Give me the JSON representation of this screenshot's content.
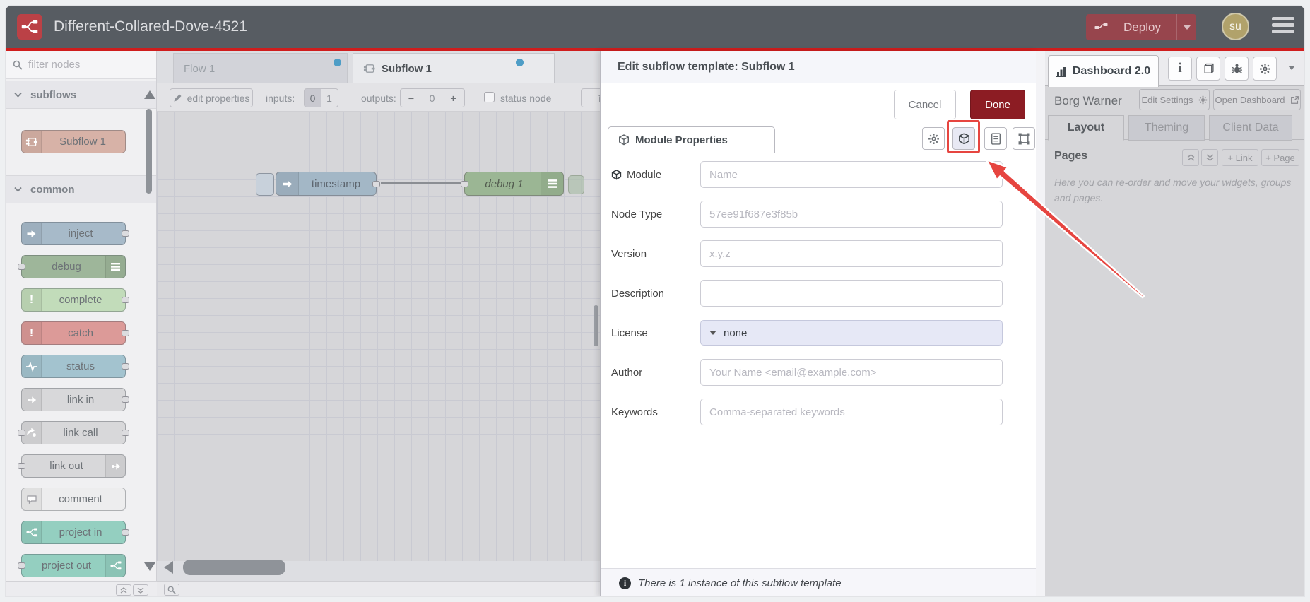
{
  "header": {
    "title": "Different-Collared-Dove-4521",
    "deploy_label": "Deploy",
    "avatar_initials": "su"
  },
  "palette": {
    "filter_placeholder": "filter nodes",
    "sections": [
      {
        "label": "subflows",
        "nodes": [
          {
            "label": "Subflow 1",
            "color": "#d7b2a7"
          }
        ]
      },
      {
        "label": "common",
        "nodes": [
          {
            "label": "inject",
            "color": "#a7bac9"
          },
          {
            "label": "debug",
            "color": "#9eb69a"
          },
          {
            "label": "complete",
            "color": "#c2dcba"
          },
          {
            "label": "catch",
            "color": "#dc9a98"
          },
          {
            "label": "status",
            "color": "#a3c3cf"
          },
          {
            "label": "link in",
            "color": "#d8d8da"
          },
          {
            "label": "link call",
            "color": "#d8d8da"
          },
          {
            "label": "link out",
            "color": "#d8d8da"
          },
          {
            "label": "comment",
            "color": "#ededee"
          },
          {
            "label": "project in",
            "color": "#94cfc0"
          },
          {
            "label": "project out",
            "color": "#94cfc0"
          }
        ]
      }
    ]
  },
  "workspace": {
    "tabs": [
      {
        "label": "Flow 1",
        "active": false
      },
      {
        "label": "Subflow 1",
        "active": true
      }
    ],
    "toolbar": {
      "edit_properties_label": "edit properties",
      "inputs_label": "inputs:",
      "input_options": [
        "0",
        "1"
      ],
      "selected_input": "0",
      "outputs_label": "outputs:",
      "minus_label": "−",
      "outputs_value": "0",
      "plus_label": "+",
      "status_node_label": "status node"
    },
    "nodes": [
      {
        "label": "timestamp"
      },
      {
        "label": "debug 1"
      }
    ]
  },
  "dialog": {
    "title": "Edit subflow template: Subflow 1",
    "cancel_label": "Cancel",
    "done_label": "Done",
    "tab_label": "Module Properties",
    "fields": [
      {
        "label": "Module",
        "placeholder": "Name",
        "type": "input"
      },
      {
        "label": "Node Type",
        "placeholder": "57ee91f687e3f85b",
        "type": "input"
      },
      {
        "label": "Version",
        "placeholder": "x.y.z",
        "type": "input"
      },
      {
        "label": "Description",
        "placeholder": "",
        "type": "input"
      },
      {
        "label": "License",
        "value": "none",
        "type": "select"
      },
      {
        "label": "Author",
        "placeholder": "Your Name <email@example.com>",
        "type": "input"
      },
      {
        "label": "Keywords",
        "placeholder": "Comma-separated keywords",
        "type": "input"
      }
    ],
    "footer_note": "There is 1 instance of this subflow template"
  },
  "sidebar": {
    "tab_label": "Dashboard 2.0",
    "project_name": "Borg Warner",
    "edit_settings_label": "Edit Settings",
    "open_dashboard_label": "Open Dashboard",
    "tabs": [
      "Layout",
      "Theming",
      "Client Data"
    ],
    "active_tab": "Layout",
    "pages_title": "Pages",
    "link_button_label": "+ Link",
    "page_button_label": "+ Page",
    "help_text": "Here you can re-order and move your widgets, groups and pages."
  },
  "colors": {
    "header_bg": "#575c62",
    "accent_red_line": "#cf1d1d",
    "done_button": "#8c1c23",
    "annotation_red": "#e64540",
    "tab_dirty_dot": "#4e9dc6"
  }
}
